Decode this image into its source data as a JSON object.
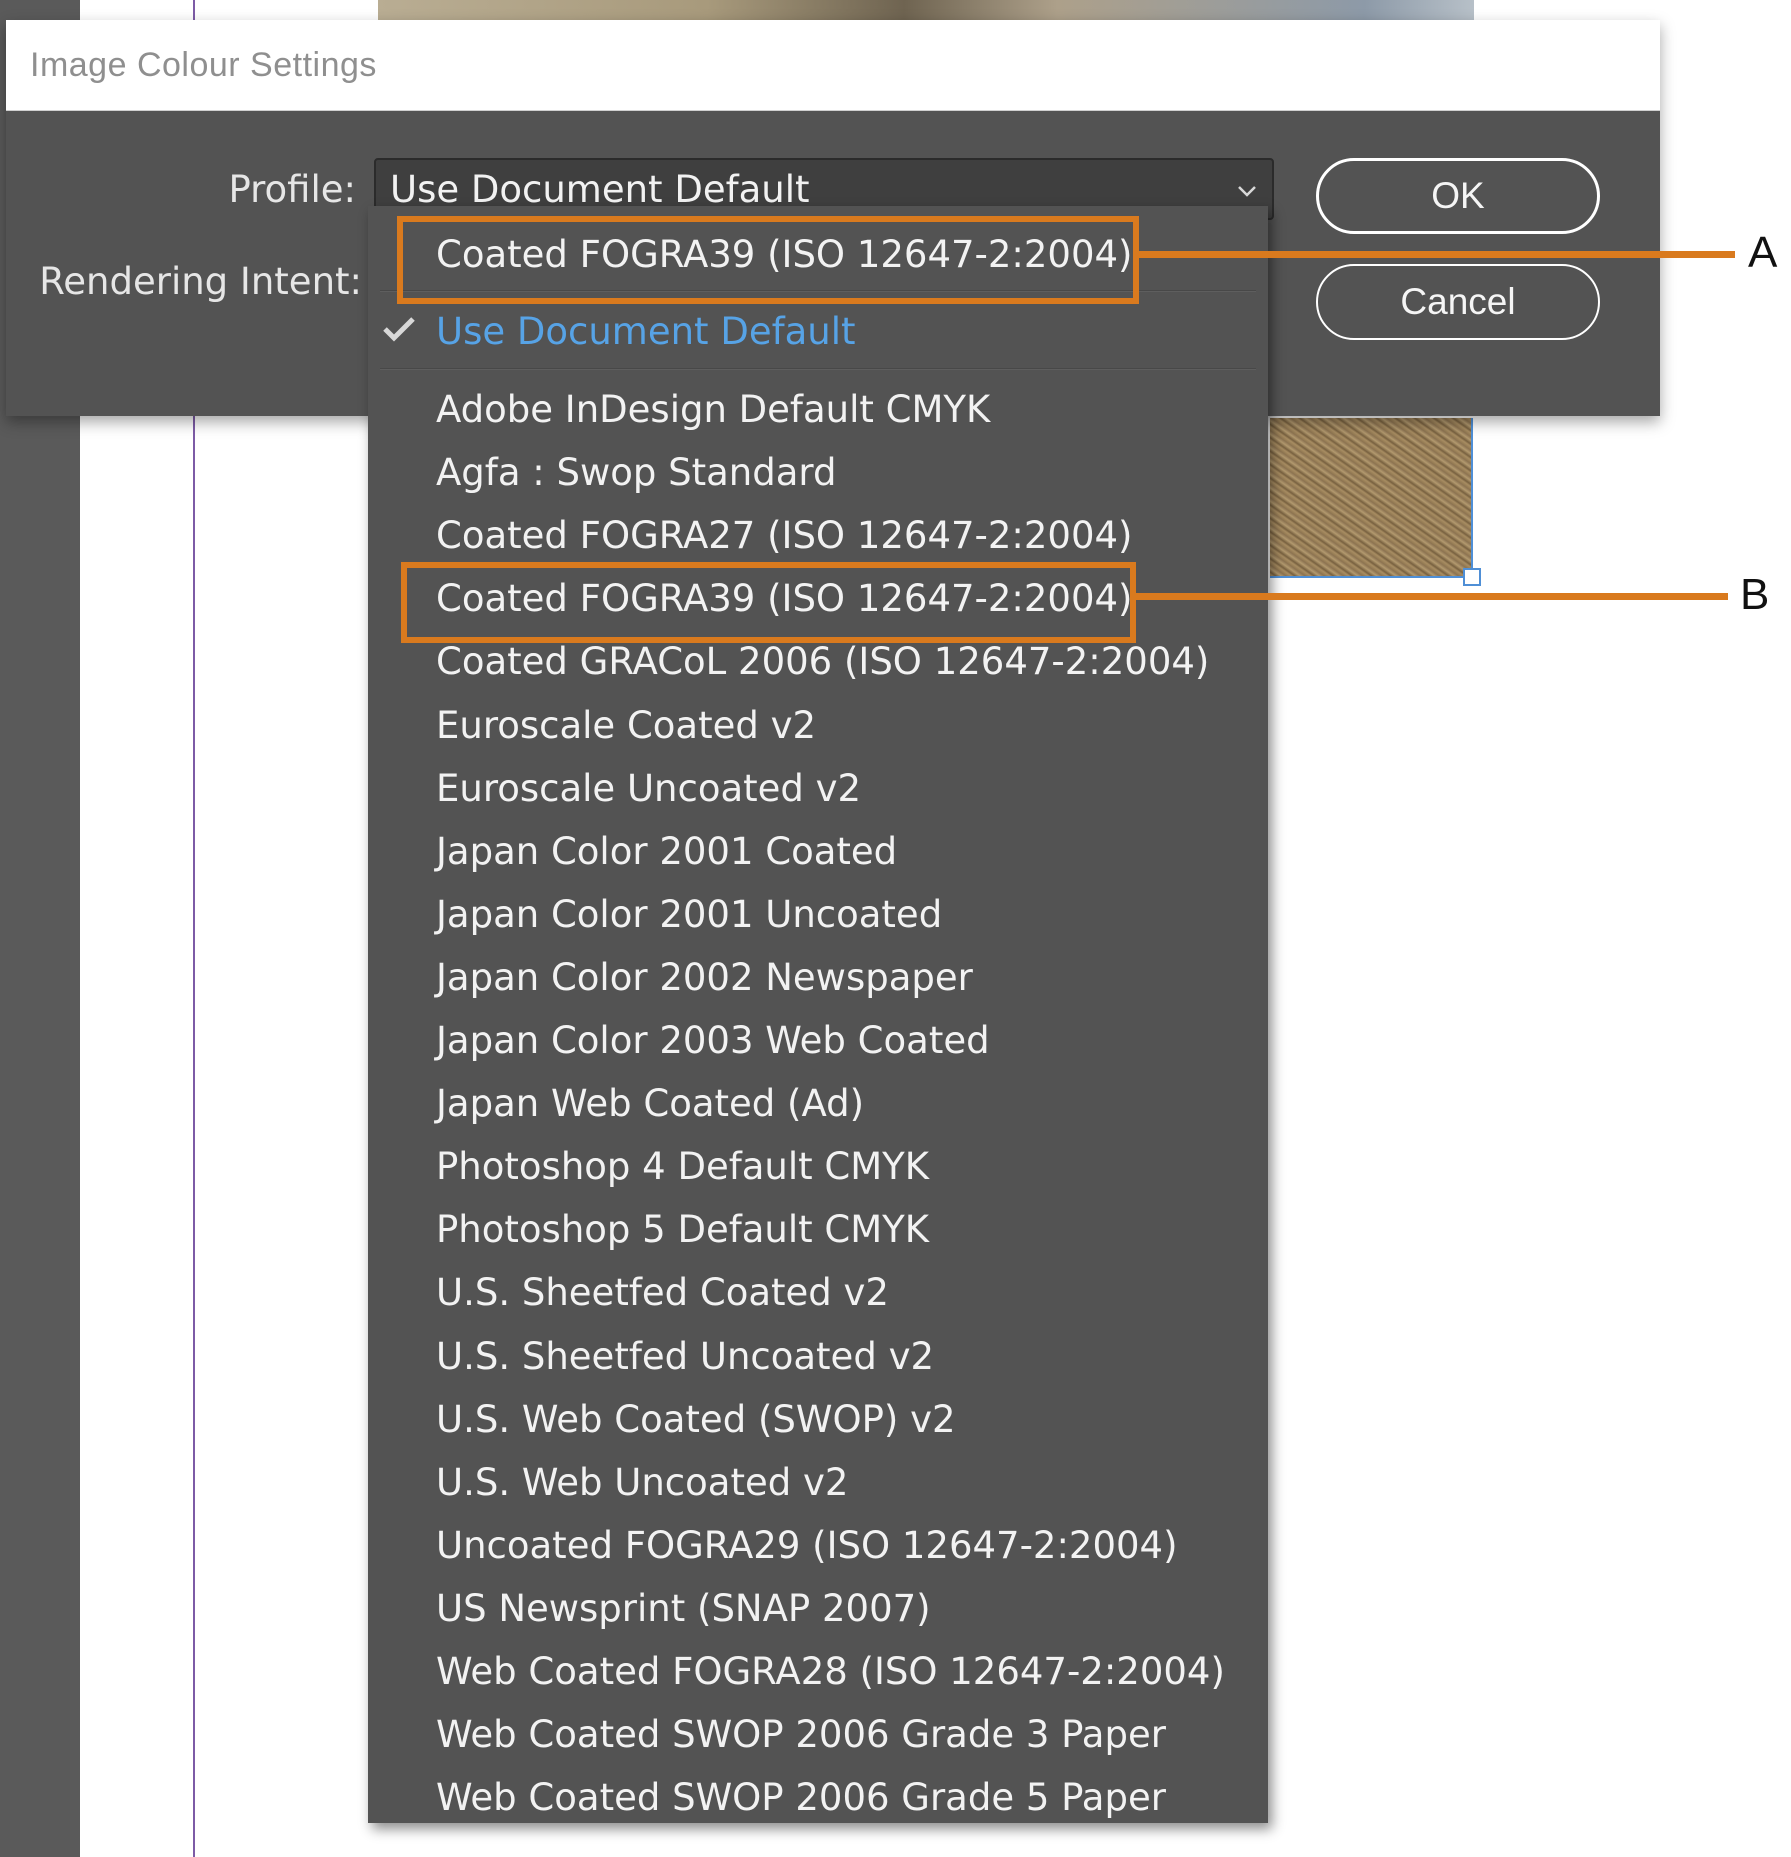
{
  "dialog": {
    "title": "Image Colour Settings",
    "profile_label": "Profile:",
    "rendering_intent_label": "Rendering Intent:",
    "profile_value": "Use Document Default",
    "ok_label": "OK",
    "cancel_label": "Cancel"
  },
  "dropdown": {
    "top_item": "Coated FOGRA39 (ISO 12647-2:2004)",
    "checked_item": "Use Document Default",
    "items": [
      "Adobe InDesign Default CMYK",
      "Agfa : Swop Standard",
      "Coated FOGRA27 (ISO 12647-2:2004)",
      "Coated FOGRA39 (ISO 12647-2:2004)",
      "Coated GRACoL 2006 (ISO 12647-2:2004)",
      "Euroscale Coated v2",
      "Euroscale Uncoated v2",
      "Japan Color 2001 Coated",
      "Japan Color 2001 Uncoated",
      "Japan Color 2002 Newspaper",
      "Japan Color 2003 Web Coated",
      "Japan Web Coated (Ad)",
      "Photoshop 4 Default CMYK",
      "Photoshop 5 Default CMYK",
      "U.S. Sheetfed Coated v2",
      "U.S. Sheetfed Uncoated v2",
      "U.S. Web Coated (SWOP) v2",
      "U.S. Web Uncoated v2",
      "Uncoated FOGRA29 (ISO 12647-2:2004)",
      "US Newsprint (SNAP 2007)",
      "Web Coated FOGRA28 (ISO 12647-2:2004)",
      "Web Coated SWOP 2006 Grade 3 Paper",
      "Web Coated SWOP 2006 Grade 5 Paper"
    ]
  },
  "annotations": {
    "a": "A",
    "b": "B"
  },
  "colors": {
    "callout": "#d97a1e",
    "checked_text": "#57a3e6",
    "dialog_bg": "#535353"
  },
  "icons": {
    "chevron": "chevron-down-icon",
    "check": "check-icon"
  }
}
